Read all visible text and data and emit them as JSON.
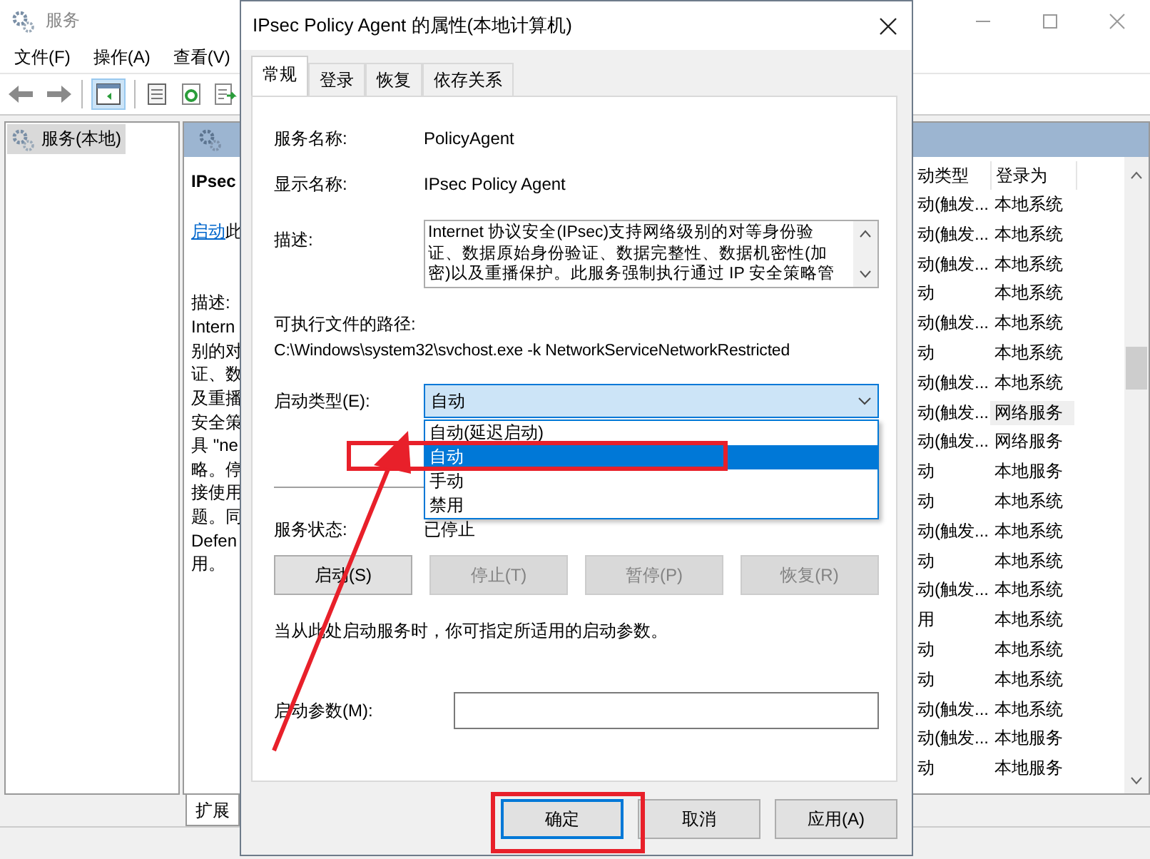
{
  "window": {
    "title": "服务",
    "menu": [
      "文件(F)",
      "操作(A)",
      "查看(V)"
    ]
  },
  "tree": [
    {
      "label": "服务(本地)",
      "selected": true
    }
  ],
  "detail": {
    "name": "IPsec",
    "start_link": "启动",
    "start_rest": "此",
    "description_label": "描述:",
    "description_lines": [
      "Intern",
      "别的对",
      "证、数",
      "及重播",
      "安全策",
      "具 \"ne",
      "略。停",
      "接使用",
      "题。同",
      "Defen",
      "用。"
    ]
  },
  "table": {
    "columns": [
      "动类型",
      "登录为"
    ],
    "rows": [
      {
        "cells": [
          "动(触发...",
          "本地系统"
        ],
        "highlighted": false
      },
      {
        "cells": [
          "动(触发...",
          "本地系统"
        ],
        "highlighted": false
      },
      {
        "cells": [
          "动(触发...",
          "本地系统"
        ],
        "highlighted": false
      },
      {
        "cells": [
          "动",
          "本地系统"
        ],
        "highlighted": false
      },
      {
        "cells": [
          "动(触发...",
          "本地系统"
        ],
        "highlighted": false
      },
      {
        "cells": [
          "动",
          "本地系统"
        ],
        "highlighted": false
      },
      {
        "cells": [
          "动(触发...",
          "本地系统"
        ],
        "highlighted": false
      },
      {
        "cells": [
          "动(触发...",
          "网络服务"
        ],
        "highlighted": true
      },
      {
        "cells": [
          "动(触发...",
          "网络服务"
        ],
        "highlighted": false
      },
      {
        "cells": [
          "动",
          "本地服务"
        ],
        "highlighted": false
      },
      {
        "cells": [
          "动",
          "本地系统"
        ],
        "highlighted": false
      },
      {
        "cells": [
          "动(触发...",
          "本地系统"
        ],
        "highlighted": false
      },
      {
        "cells": [
          "动",
          "本地系统"
        ],
        "highlighted": false
      },
      {
        "cells": [
          "动(触发...",
          "本地系统"
        ],
        "highlighted": false
      },
      {
        "cells": [
          "用",
          "本地系统"
        ],
        "highlighted": false
      },
      {
        "cells": [
          "动",
          "本地系统"
        ],
        "highlighted": false
      },
      {
        "cells": [
          "动",
          "本地系统"
        ],
        "highlighted": false
      },
      {
        "cells": [
          "动(触发...",
          "本地系统"
        ],
        "highlighted": false
      },
      {
        "cells": [
          "动(触发...",
          "本地服务"
        ],
        "highlighted": false
      },
      {
        "cells": [
          "动",
          "本地服务"
        ],
        "highlighted": false
      }
    ]
  },
  "bottom_tabs": [
    {
      "label": "扩展",
      "selected": true
    }
  ],
  "dialog": {
    "title": "IPsec Policy Agent 的属性(本地计算机)",
    "tabs": [
      {
        "label": "常规",
        "selected": true
      },
      {
        "label": "登录",
        "selected": false
      },
      {
        "label": "恢复",
        "selected": false
      },
      {
        "label": "依存关系",
        "selected": false
      }
    ],
    "fields": [
      {
        "label": "服务名称:",
        "value": "PolicyAgent"
      },
      {
        "label": "显示名称:",
        "value": "IPsec Policy Agent"
      }
    ],
    "description": {
      "label": "描述:",
      "lines": [
        "Internet 协议安全(IPsec)支持网络级别的对等身份验",
        "证、数据原始身份验证、数据完整性、数据机密性(加",
        "密)以及重播保护。此服务强制执行通过 IP 安全策略管"
      ]
    },
    "path_label": "可执行文件的路径:",
    "path": "C:\\Windows\\system32\\svchost.exe -k NetworkServiceNetworkRestricted",
    "startup": {
      "label": "启动类型(E):",
      "value": "自动",
      "expanded": true,
      "options": [
        {
          "label": "自动(延迟启动)",
          "selected": false
        },
        {
          "label": "自动",
          "selected": true
        },
        {
          "label": "手动",
          "selected": false
        },
        {
          "label": "禁用",
          "selected": false
        }
      ]
    },
    "status": {
      "label": "服务状态:",
      "value": "已停止"
    },
    "service_buttons": [
      {
        "label": "启动(S)",
        "disabled": false
      },
      {
        "label": "停止(T)",
        "disabled": true
      },
      {
        "label": "暂停(P)",
        "disabled": true
      },
      {
        "label": "恢复(R)",
        "disabled": true
      }
    ],
    "note": "当从此处启动服务时，你可指定所适用的启动参数。",
    "params": {
      "label": "启动参数(M):"
    },
    "buttons": [
      {
        "label": "确定",
        "focused": true
      },
      {
        "label": "取消",
        "focused": false
      },
      {
        "label": "应用(A)",
        "focused": false
      }
    ]
  }
}
